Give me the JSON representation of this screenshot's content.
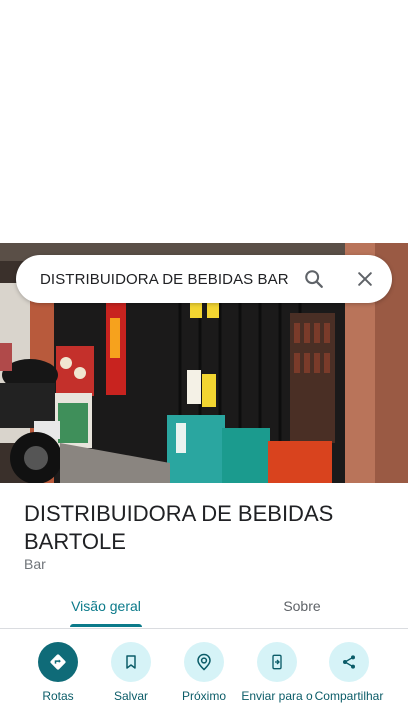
{
  "search": {
    "query": "DISTRIBUIDORA DE BEBIDAS BARTOLE",
    "search_icon": "search-icon",
    "close_icon": "close-icon"
  },
  "place": {
    "name": "DISTRIBUIDORA DE BEBIDAS BARTOLE",
    "category": "Bar"
  },
  "tabs": [
    {
      "label": "Visão geral",
      "selected": true
    },
    {
      "label": "Sobre",
      "selected": false
    }
  ],
  "actions": [
    {
      "label": "Rotas",
      "icon": "directions-icon"
    },
    {
      "label": "Salvar",
      "icon": "bookmark-icon"
    },
    {
      "label": "Próximo",
      "icon": "nearby-icon"
    },
    {
      "label": "Enviar para o",
      "icon": "send-to-phone-icon"
    },
    {
      "label": "Compartilhar",
      "icon": "share-icon"
    }
  ],
  "colors": {
    "accent": "#0b7a8a",
    "action_bg": "#d6f3f7",
    "primary_action_bg": "#0f6b78"
  }
}
